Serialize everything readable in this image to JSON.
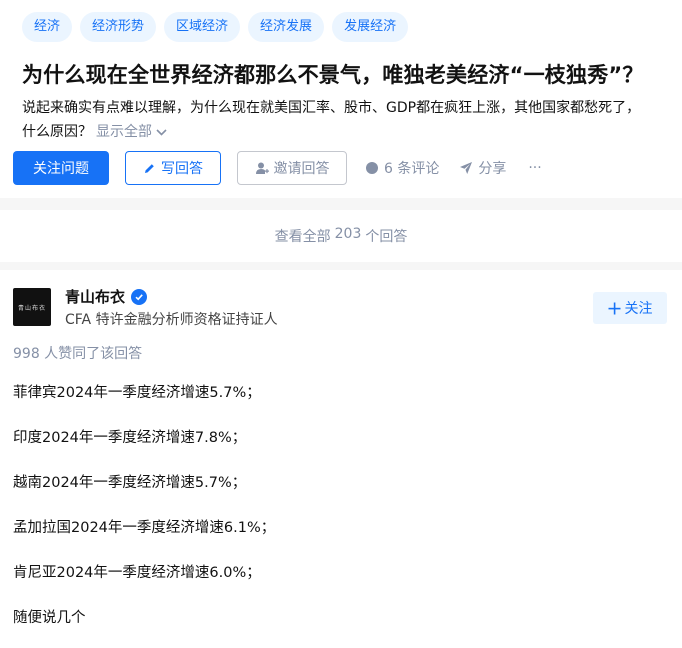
{
  "question": {
    "topics": [
      "经济",
      "经济形势",
      "区域经济",
      "经济发展",
      "发展经济"
    ],
    "title": "为什么现在全世界经济都那么不景气，唯独老美经济“一枝独秀”？",
    "detail_line1": "说起来确实有点难以理解，为什么现在就美国汇率、股市、GDP都在疯狂上涨，其他国家都愁死了，",
    "detail_line2": "什么原因？",
    "show_all": "显示全部"
  },
  "actions": {
    "follow_question": "关注问题",
    "write_answer": "写回答",
    "invite_answer": "邀请回答",
    "comments": "6 条评论",
    "share": "分享",
    "more": "···"
  },
  "view_all": {
    "prefix": "查看全部",
    "count": "203",
    "suffix": "个回答"
  },
  "answer": {
    "avatar_text": "青山布衣",
    "author_name": "青山布衣",
    "author_bio": "CFA 特许金融分析师资格证持证人",
    "follow_label": "关注",
    "votes_text": "998 人赞同了该回答",
    "paragraphs": [
      "菲律宾2024年一季度经济增速5.7%；",
      "印度2024年一季度经济增速7.8%；",
      "越南2024年一季度经济增速5.7%；",
      "孟加拉国2024年一季度经济增速6.1%；",
      "肯尼亚2024年一季度经济增速6.0%；",
      "随便说几个"
    ]
  },
  "colors": {
    "brand_blue": "#1772f6",
    "tag_bg": "#ebf5ff",
    "muted_gray": "#8590a6"
  },
  "icons": [
    "pen-icon",
    "invite-user-icon",
    "comment-bubble-icon",
    "share-plane-icon",
    "verified-badge-icon",
    "plus-icon",
    "chevron-down-icon"
  ]
}
